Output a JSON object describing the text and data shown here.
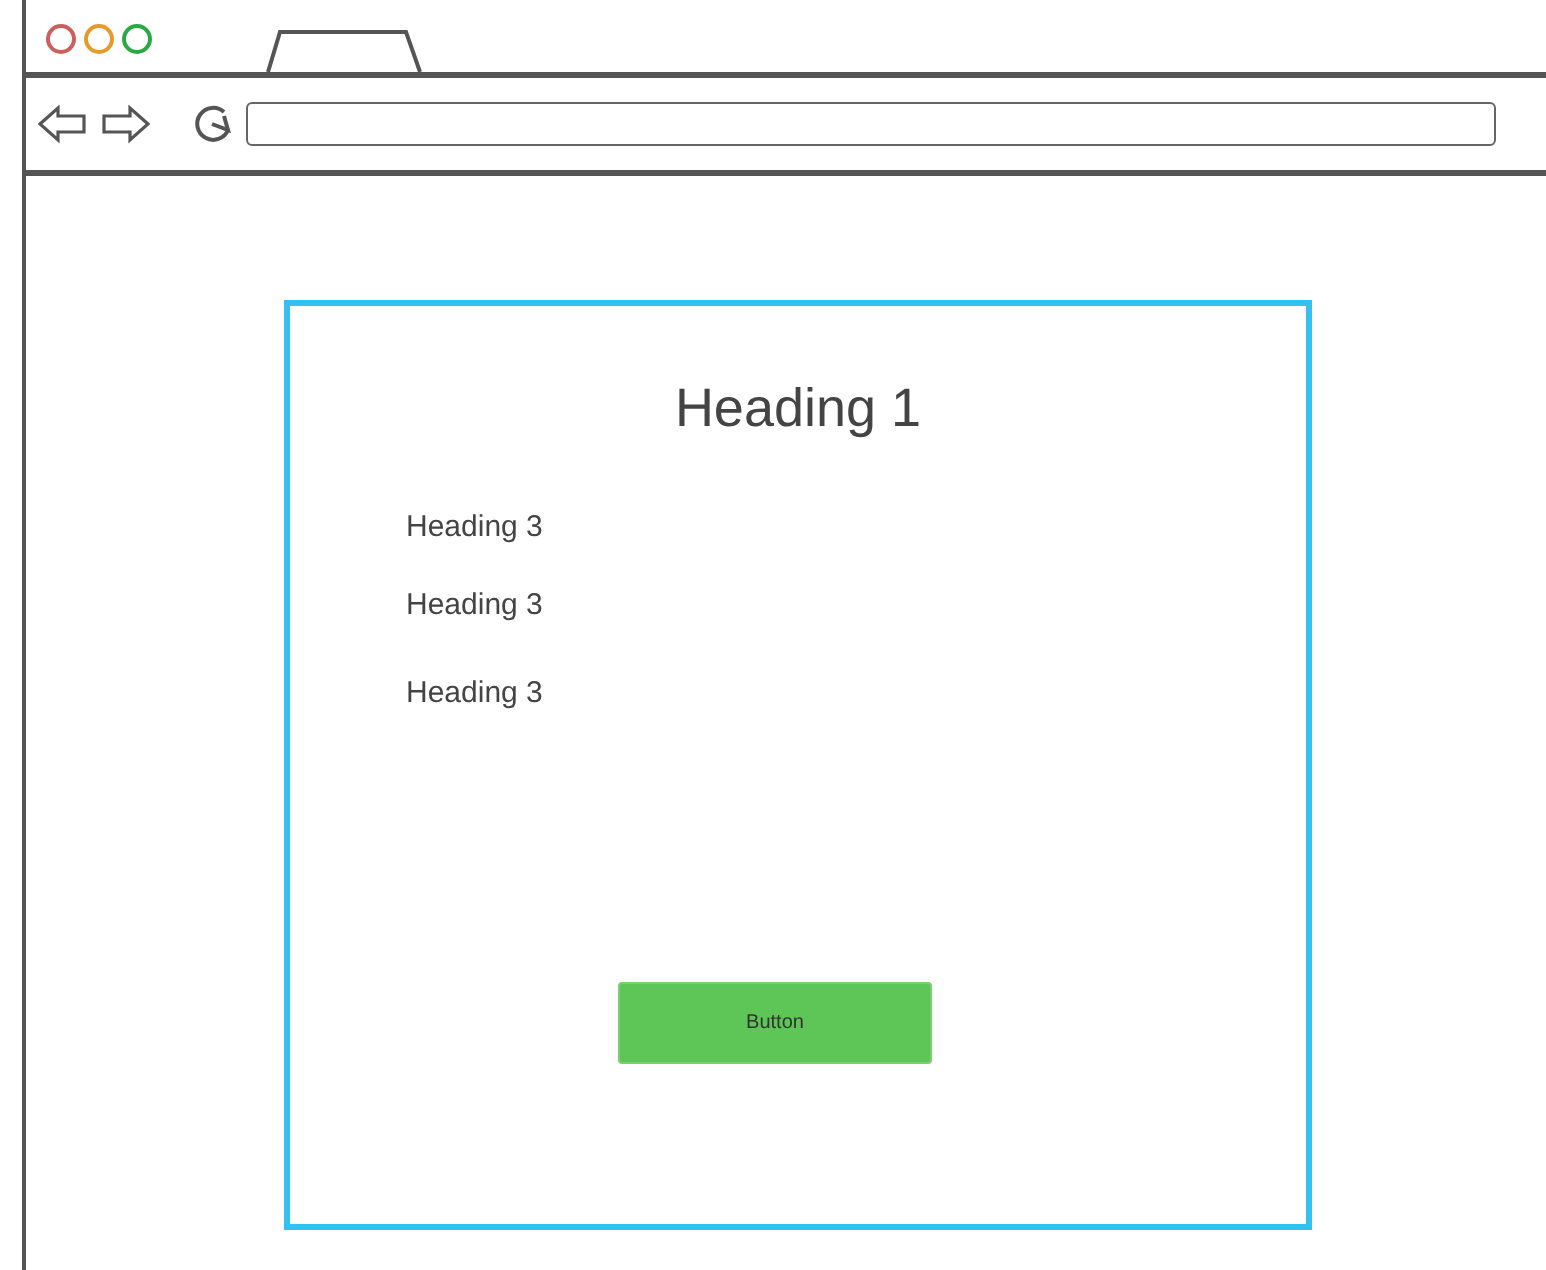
{
  "page": {
    "heading": "Heading 1",
    "subheadings": [
      "Heading 3",
      "Heading 3",
      "Heading 3"
    ],
    "button": "Button"
  }
}
